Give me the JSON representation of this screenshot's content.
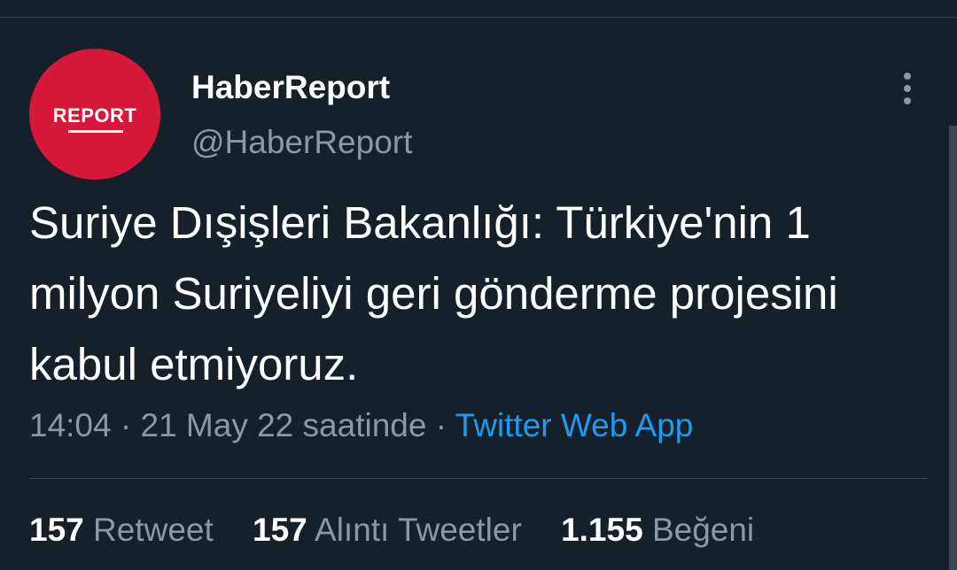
{
  "colors": {
    "background": "#15202b",
    "avatar_red": "#d6193a",
    "secondary_text": "#8b98a5",
    "link_blue": "#1d9bf0",
    "divider": "#38444d"
  },
  "author": {
    "avatar_text": "REPORT",
    "display_name": "HaberReport",
    "handle": "@HaberReport"
  },
  "tweet": {
    "text": "Suriye Dışişleri Bakanlığı: Türkiye'nin 1 milyon Suriyeliyi geri gönderme projesini kabul etmiyoruz."
  },
  "meta": {
    "time": "14:04",
    "separator": " · ",
    "date": "21 May 22 saatinde",
    "source": "Twitter Web App"
  },
  "stats": {
    "retweets": {
      "count": "157",
      "label": "Retweet"
    },
    "quotes": {
      "count": "157",
      "label": "Alıntı Tweetler"
    },
    "likes": {
      "count": "1.155",
      "label": "Beğeni"
    }
  },
  "icons": {
    "more": "more-vertical-icon"
  }
}
